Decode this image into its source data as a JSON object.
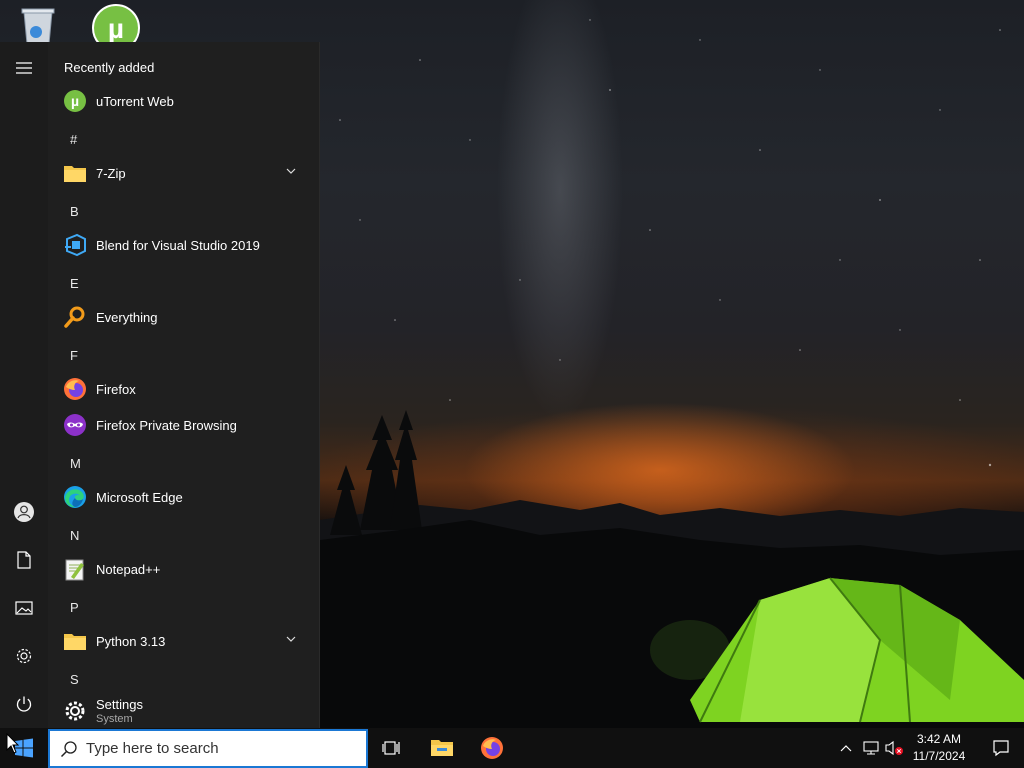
{
  "start_menu": {
    "section_title": "Recently added",
    "recent": [
      {
        "label": "uTorrent Web",
        "icon": "utorrent-icon"
      }
    ],
    "groups": [
      {
        "letter": "#",
        "apps": [
          {
            "label": "7-Zip",
            "icon": "folder-icon",
            "expandable": true
          }
        ]
      },
      {
        "letter": "B",
        "apps": [
          {
            "label": "Blend for Visual Studio 2019",
            "icon": "blend-icon"
          }
        ]
      },
      {
        "letter": "E",
        "apps": [
          {
            "label": "Everything",
            "icon": "magnifier-icon"
          }
        ]
      },
      {
        "letter": "F",
        "apps": [
          {
            "label": "Firefox",
            "icon": "firefox-icon"
          },
          {
            "label": "Firefox Private Browsing",
            "icon": "firefox-private-icon"
          }
        ]
      },
      {
        "letter": "M",
        "apps": [
          {
            "label": "Microsoft Edge",
            "icon": "edge-icon"
          }
        ]
      },
      {
        "letter": "N",
        "apps": [
          {
            "label": "Notepad++",
            "icon": "notepadpp-icon"
          }
        ]
      },
      {
        "letter": "P",
        "apps": [
          {
            "label": "Python 3.13",
            "icon": "folder-icon",
            "expandable": true
          }
        ]
      },
      {
        "letter": "S",
        "apps": [
          {
            "label": "Settings",
            "sublabel": "System",
            "icon": "gear-icon"
          }
        ]
      }
    ],
    "rail": [
      "hamburger-icon",
      "user-icon",
      "document-icon",
      "pictures-icon",
      "settings-icon",
      "power-icon"
    ]
  },
  "taskbar": {
    "search_placeholder": "Type here to search",
    "pinned": [
      "task-view-icon",
      "file-explorer-icon",
      "firefox-icon"
    ],
    "clock_time": "3:42 AM",
    "clock_date": "11/7/2024"
  },
  "colors": {
    "menu_bg": "#1f1f1f",
    "taskbar_bg": "#101010",
    "search_border": "#1b78d4",
    "tent_green": "#7ed321"
  }
}
